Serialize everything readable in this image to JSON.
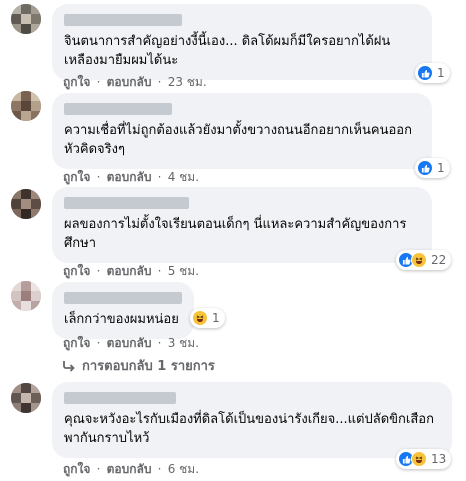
{
  "comments": [
    {
      "text": "จินตนาการสำคัญอย่างงี้นี้เอง... ดิลโด้ผมก็มีใครอยากได้ฝนเหลืองมายืมผมได้นะ",
      "like": "ถูกใจ",
      "reply": "ตอบกลับ",
      "time": "23 ชม.",
      "reaction_count": "1",
      "reaction_types": [
        "like"
      ]
    },
    {
      "text": "ความเชื่อที่ไม่ถูกต้องแล้วยังมาตั้งขวางถนนอีกอยากเห็นคนออกหัวคิดจริงๆ",
      "like": "ถูกใจ",
      "reply": "ตอบกลับ",
      "time": "4 ชม.",
      "reaction_count": "1",
      "reaction_types": [
        "like"
      ]
    },
    {
      "text": "ผลของการไม่ตั้งใจเรียนตอนเด็กๆ นี่แหละความสำคัญของการศึกษา",
      "like": "ถูกใจ",
      "reply": "ตอบกลับ",
      "time": "5 ชม.",
      "reaction_count": "22",
      "reaction_types": [
        "like",
        "haha"
      ]
    },
    {
      "text": "เล็กกว่าของผมหน่อย",
      "like": "ถูกใจ",
      "reply": "ตอบกลับ",
      "time": "3 ชม.",
      "reaction_count": "1",
      "reaction_types": [
        "haha"
      ]
    },
    {
      "text": "คุณจะหวังอะไรกับเมืองที่ดิลโด้เป็นของน่ารังเกียจ...แต่ปลัดขิกเสือกพากันกราบไหว้",
      "like": "ถูกใจ",
      "reply": "ตอบกลับ",
      "time": "6 ชม.",
      "reaction_count": "13",
      "reaction_types": [
        "like",
        "haha"
      ]
    }
  ],
  "view_replies": "การตอบกลับ 1 รายการ",
  "separator": "·",
  "colors": {
    "bubble": "#f0f2f5",
    "meta": "#65676b",
    "like_blue": "#1877f2",
    "haha_yellow": "#f7c33b"
  }
}
